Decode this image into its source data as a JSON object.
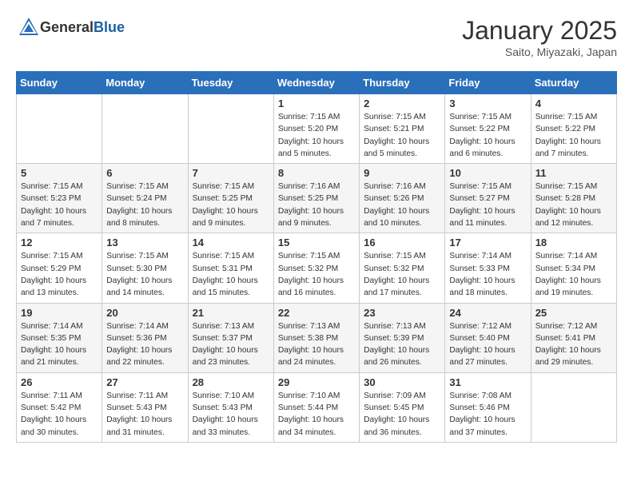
{
  "header": {
    "logo_general": "General",
    "logo_blue": "Blue",
    "month": "January 2025",
    "location": "Saito, Miyazaki, Japan"
  },
  "days_of_week": [
    "Sunday",
    "Monday",
    "Tuesday",
    "Wednesday",
    "Thursday",
    "Friday",
    "Saturday"
  ],
  "weeks": [
    [
      {
        "day": "",
        "info": ""
      },
      {
        "day": "",
        "info": ""
      },
      {
        "day": "",
        "info": ""
      },
      {
        "day": "1",
        "info": "Sunrise: 7:15 AM\nSunset: 5:20 PM\nDaylight: 10 hours\nand 5 minutes."
      },
      {
        "day": "2",
        "info": "Sunrise: 7:15 AM\nSunset: 5:21 PM\nDaylight: 10 hours\nand 5 minutes."
      },
      {
        "day": "3",
        "info": "Sunrise: 7:15 AM\nSunset: 5:22 PM\nDaylight: 10 hours\nand 6 minutes."
      },
      {
        "day": "4",
        "info": "Sunrise: 7:15 AM\nSunset: 5:22 PM\nDaylight: 10 hours\nand 7 minutes."
      }
    ],
    [
      {
        "day": "5",
        "info": "Sunrise: 7:15 AM\nSunset: 5:23 PM\nDaylight: 10 hours\nand 7 minutes."
      },
      {
        "day": "6",
        "info": "Sunrise: 7:15 AM\nSunset: 5:24 PM\nDaylight: 10 hours\nand 8 minutes."
      },
      {
        "day": "7",
        "info": "Sunrise: 7:15 AM\nSunset: 5:25 PM\nDaylight: 10 hours\nand 9 minutes."
      },
      {
        "day": "8",
        "info": "Sunrise: 7:16 AM\nSunset: 5:25 PM\nDaylight: 10 hours\nand 9 minutes."
      },
      {
        "day": "9",
        "info": "Sunrise: 7:16 AM\nSunset: 5:26 PM\nDaylight: 10 hours\nand 10 minutes."
      },
      {
        "day": "10",
        "info": "Sunrise: 7:15 AM\nSunset: 5:27 PM\nDaylight: 10 hours\nand 11 minutes."
      },
      {
        "day": "11",
        "info": "Sunrise: 7:15 AM\nSunset: 5:28 PM\nDaylight: 10 hours\nand 12 minutes."
      }
    ],
    [
      {
        "day": "12",
        "info": "Sunrise: 7:15 AM\nSunset: 5:29 PM\nDaylight: 10 hours\nand 13 minutes."
      },
      {
        "day": "13",
        "info": "Sunrise: 7:15 AM\nSunset: 5:30 PM\nDaylight: 10 hours\nand 14 minutes."
      },
      {
        "day": "14",
        "info": "Sunrise: 7:15 AM\nSunset: 5:31 PM\nDaylight: 10 hours\nand 15 minutes."
      },
      {
        "day": "15",
        "info": "Sunrise: 7:15 AM\nSunset: 5:32 PM\nDaylight: 10 hours\nand 16 minutes."
      },
      {
        "day": "16",
        "info": "Sunrise: 7:15 AM\nSunset: 5:32 PM\nDaylight: 10 hours\nand 17 minutes."
      },
      {
        "day": "17",
        "info": "Sunrise: 7:14 AM\nSunset: 5:33 PM\nDaylight: 10 hours\nand 18 minutes."
      },
      {
        "day": "18",
        "info": "Sunrise: 7:14 AM\nSunset: 5:34 PM\nDaylight: 10 hours\nand 19 minutes."
      }
    ],
    [
      {
        "day": "19",
        "info": "Sunrise: 7:14 AM\nSunset: 5:35 PM\nDaylight: 10 hours\nand 21 minutes."
      },
      {
        "day": "20",
        "info": "Sunrise: 7:14 AM\nSunset: 5:36 PM\nDaylight: 10 hours\nand 22 minutes."
      },
      {
        "day": "21",
        "info": "Sunrise: 7:13 AM\nSunset: 5:37 PM\nDaylight: 10 hours\nand 23 minutes."
      },
      {
        "day": "22",
        "info": "Sunrise: 7:13 AM\nSunset: 5:38 PM\nDaylight: 10 hours\nand 24 minutes."
      },
      {
        "day": "23",
        "info": "Sunrise: 7:13 AM\nSunset: 5:39 PM\nDaylight: 10 hours\nand 26 minutes."
      },
      {
        "day": "24",
        "info": "Sunrise: 7:12 AM\nSunset: 5:40 PM\nDaylight: 10 hours\nand 27 minutes."
      },
      {
        "day": "25",
        "info": "Sunrise: 7:12 AM\nSunset: 5:41 PM\nDaylight: 10 hours\nand 29 minutes."
      }
    ],
    [
      {
        "day": "26",
        "info": "Sunrise: 7:11 AM\nSunset: 5:42 PM\nDaylight: 10 hours\nand 30 minutes."
      },
      {
        "day": "27",
        "info": "Sunrise: 7:11 AM\nSunset: 5:43 PM\nDaylight: 10 hours\nand 31 minutes."
      },
      {
        "day": "28",
        "info": "Sunrise: 7:10 AM\nSunset: 5:43 PM\nDaylight: 10 hours\nand 33 minutes."
      },
      {
        "day": "29",
        "info": "Sunrise: 7:10 AM\nSunset: 5:44 PM\nDaylight: 10 hours\nand 34 minutes."
      },
      {
        "day": "30",
        "info": "Sunrise: 7:09 AM\nSunset: 5:45 PM\nDaylight: 10 hours\nand 36 minutes."
      },
      {
        "day": "31",
        "info": "Sunrise: 7:08 AM\nSunset: 5:46 PM\nDaylight: 10 hours\nand 37 minutes."
      },
      {
        "day": "",
        "info": ""
      }
    ]
  ]
}
